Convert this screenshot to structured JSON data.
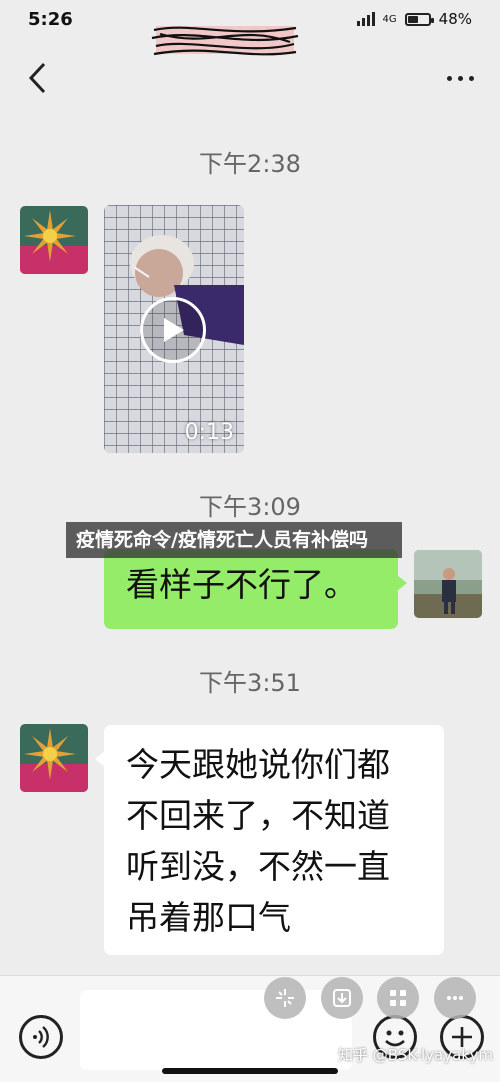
{
  "status_bar": {
    "time": "5:26",
    "battery": "48%",
    "battery_level": 0.48,
    "network": "4G"
  },
  "navbar": {
    "back_icon": "chevron-left-icon",
    "more_icon": "more-dots-icon"
  },
  "messages": [
    {
      "type": "timestamp",
      "text": "下午2:38"
    },
    {
      "type": "video",
      "sender": "them",
      "duration": "0:13"
    },
    {
      "type": "timestamp",
      "text": "下午3:09"
    },
    {
      "type": "text",
      "sender": "me",
      "text": "看样子不行了。"
    },
    {
      "type": "timestamp",
      "text": "下午3:51"
    },
    {
      "type": "text",
      "sender": "them",
      "lines": [
        "今天跟她说你们都",
        "不回来了，不知道",
        "听到没，不然一直",
        "吊着那口气"
      ]
    }
  ],
  "overlay_banner": "疫情死命令/疫情死亡人员有补偿吗",
  "input_bar": {
    "voice_icon": "voice-icon",
    "emoji_icon": "emoji-icon",
    "plus_icon": "plus-icon"
  },
  "floating_actions": [
    "flower-icon",
    "download-icon",
    "grid-icon",
    "more-icon"
  ],
  "watermark": "知乎 @BSK-lyayakym",
  "colors": {
    "background": "#ededed",
    "my_bubble": "#95ec69",
    "their_bubble": "#ffffff",
    "timestamp_text": "#666666"
  }
}
